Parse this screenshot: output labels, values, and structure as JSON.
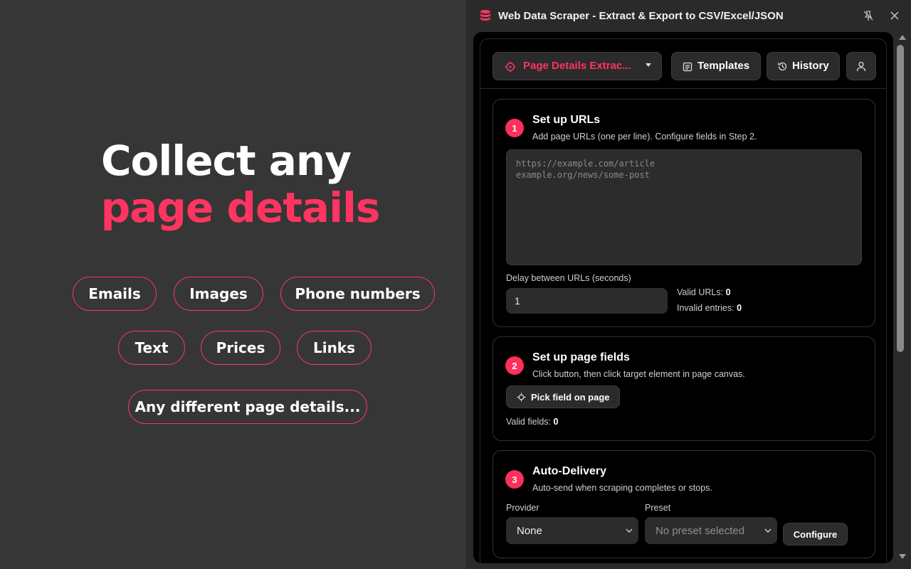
{
  "promo": {
    "headline_line1": "Collect any",
    "headline_line2": "page details",
    "pills": [
      "Emails",
      "Images",
      "Phone numbers",
      "Text",
      "Prices",
      "Links",
      "Any different page details..."
    ]
  },
  "window": {
    "title": "Web Data Scraper - Extract & Export to CSV/Excel/JSON",
    "icons": {
      "app": "database-icon",
      "pin": "pin-icon",
      "close": "close-icon"
    }
  },
  "toolbar": {
    "mode_label": "Page Details Extrac...",
    "templates_label": "Templates",
    "history_label": "History"
  },
  "step1": {
    "number": "1",
    "title": "Set up URLs",
    "description": "Add page URLs (one per line). Configure fields in Step 2.",
    "urls_placeholder": "https://example.com/article\nexample.org/news/some-post",
    "delay_label": "Delay between URLs (seconds)",
    "delay_value": "1",
    "valid_urls_label": "Valid URLs:",
    "valid_urls_count": "0",
    "invalid_entries_label": "Invalid entries:",
    "invalid_entries_count": "0"
  },
  "step2": {
    "number": "2",
    "title": "Set up page fields",
    "description": "Click button, then click target element in page canvas.",
    "pick_button_label": "Pick field on page",
    "valid_fields_label": "Valid fields:",
    "valid_fields_count": "0"
  },
  "step3": {
    "number": "3",
    "title": "Auto-Delivery",
    "description": "Auto-send when scraping completes or stops.",
    "provider_label": "Provider",
    "provider_value": "None",
    "preset_label": "Preset",
    "preset_value": "No preset selected",
    "configure_label": "Configure"
  },
  "colors": {
    "accent": "#ff3460",
    "step_badge": "#ff2f5c",
    "panel_bg": "#000000",
    "promo_bg": "#363636"
  }
}
